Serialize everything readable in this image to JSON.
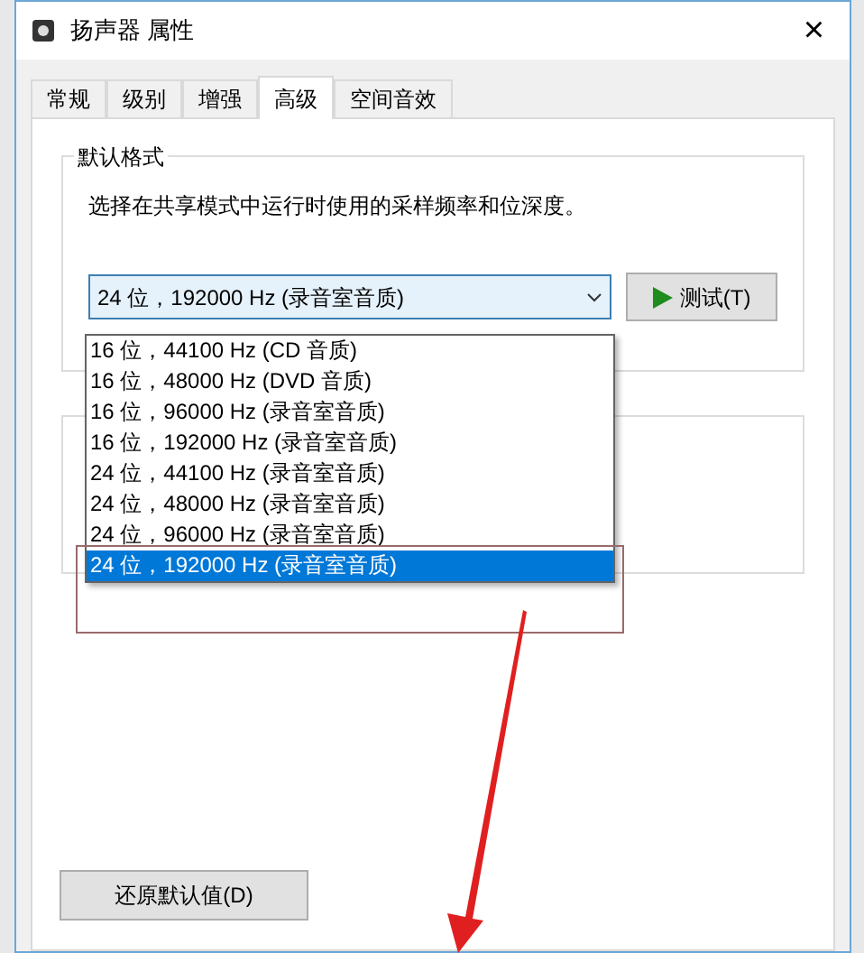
{
  "window": {
    "title": "扬声器 属性",
    "close": "×"
  },
  "tabs": [
    {
      "label": "常规",
      "selected": false
    },
    {
      "label": "级别",
      "selected": false
    },
    {
      "label": "增强",
      "selected": false
    },
    {
      "label": "高级",
      "selected": true
    },
    {
      "label": "空间音效",
      "selected": false
    }
  ],
  "default_format": {
    "title": "默认格式",
    "description": "选择在共享模式中运行时使用的采样频率和位深度。",
    "value": "24 位，192000 Hz (录音室音质)",
    "test_button": "测试(T)",
    "options": [
      {
        "label": "16 位，44100 Hz (CD 音质)",
        "selected": false
      },
      {
        "label": "16 位，48000 Hz (DVD 音质)",
        "selected": false
      },
      {
        "label": "16 位，96000 Hz (录音室音质)",
        "selected": false
      },
      {
        "label": "16 位，192000 Hz (录音室音质)",
        "selected": false
      },
      {
        "label": "24 位，44100 Hz (录音室音质)",
        "selected": false
      },
      {
        "label": "24 位，48000 Hz (录音室音质)",
        "selected": false
      },
      {
        "label": "24 位，96000 Hz (录音室音质)",
        "selected": false
      },
      {
        "label": "24 位，192000 Hz (录音室音质)",
        "selected": true
      }
    ]
  },
  "restore_button": "还原默认值(D)"
}
